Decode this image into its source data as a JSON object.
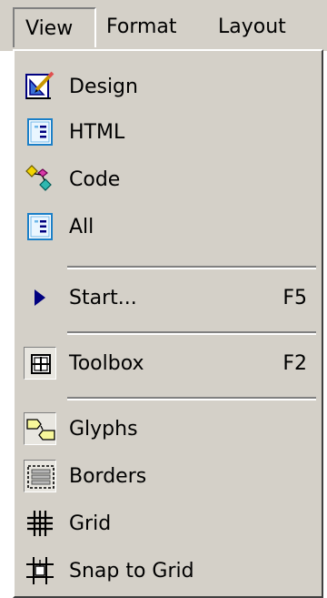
{
  "menubar": {
    "items": [
      {
        "label": "View"
      },
      {
        "label": "Format"
      },
      {
        "label": "Layout"
      }
    ]
  },
  "menu": {
    "items": [
      {
        "label": "Design",
        "icon": "design-view-icon"
      },
      {
        "label": "HTML",
        "icon": "html-page-icon"
      },
      {
        "label": "Code",
        "icon": "code-view-icon"
      },
      {
        "label": "All",
        "icon": "all-view-icon"
      },
      {
        "label": "Start...",
        "shortcut": "F5",
        "icon": "start-triangle-icon"
      },
      {
        "label": "Toolbox",
        "shortcut": "F2",
        "icon": "toolbox-icon",
        "checked": true
      },
      {
        "label": "Glyphs",
        "icon": "glyphs-icon",
        "checked": true
      },
      {
        "label": "Borders",
        "icon": "borders-icon",
        "checked": true
      },
      {
        "label": "Grid",
        "icon": "grid-icon"
      },
      {
        "label": "Snap to Grid",
        "icon": "snap-to-grid-icon"
      }
    ]
  },
  "colors": {
    "menu_bg": "#d4d0c8",
    "accent_blue": "#00007f",
    "separator_dark": "#808080"
  }
}
